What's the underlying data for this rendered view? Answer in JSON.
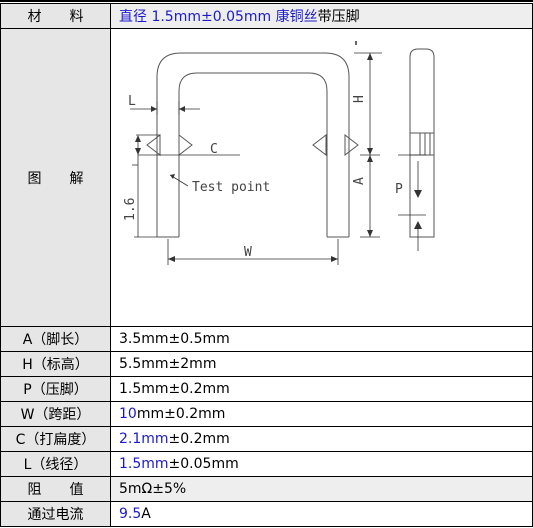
{
  "material": {
    "label": "材　　料",
    "value_prefix": "直径 1.5mm±0.05mm 康铜丝",
    "value_suffix": "带压脚"
  },
  "diagram": {
    "label": "图　　解",
    "top_mark": "^^^^^",
    "dim_L": "L",
    "dim_H": "H",
    "dim_C": "C",
    "dim_A": "A",
    "dim_P": "P",
    "dim_16": "1.6",
    "dim_W": "W",
    "test_point": "Test point"
  },
  "specs": [
    {
      "label": "A（脚长）",
      "value_main": "3.5mm±0.5mm",
      "value_blue": "",
      "value_rest": ""
    },
    {
      "label": "H（标高）",
      "value_main": "5.5mm±2mm",
      "value_blue": "",
      "value_rest": ""
    },
    {
      "label": "P（压脚）",
      "value_main": "1.5mm±0.2mm",
      "value_blue": "",
      "value_rest": ""
    },
    {
      "label": "W（跨距）",
      "value_main": "",
      "value_blue": "10",
      "value_rest": "mm±0.2mm"
    },
    {
      "label": "C（打扁度）",
      "value_main": "",
      "value_blue": "2.1mm",
      "value_rest": "±0.2mm"
    },
    {
      "label": "L（线径）",
      "value_main": "",
      "value_blue": "1.5mm",
      "value_rest": "±0.05mm"
    }
  ],
  "resistance": {
    "label": "阻　　值",
    "value": "5mΩ±5%"
  },
  "current": {
    "label": "通过电流",
    "value_blue": "9.5",
    "value_rest": "A"
  }
}
